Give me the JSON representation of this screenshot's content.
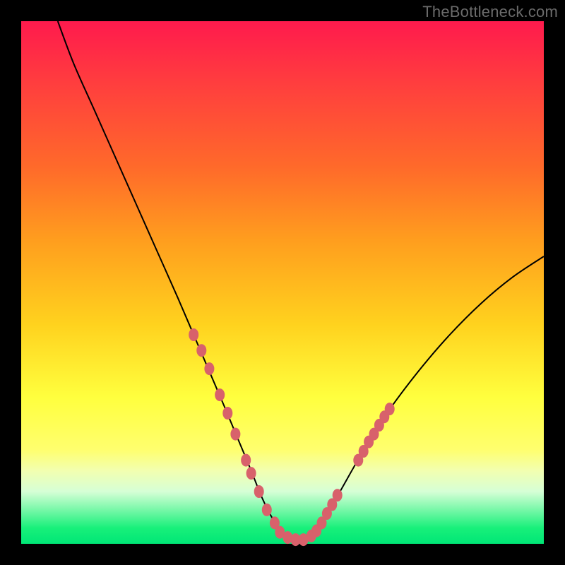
{
  "watermark": "TheBottleneck.com",
  "colors": {
    "frame": "#000000",
    "gradient_top": "#ff1a4d",
    "gradient_bottom": "#00e676",
    "curve": "#000000",
    "beads": "#d8616b"
  },
  "chart_data": {
    "type": "line",
    "title": "",
    "xlabel": "",
    "ylabel": "",
    "xlim": [
      0,
      100
    ],
    "ylim": [
      0,
      100
    ],
    "series": [
      {
        "name": "bottleneck-curve",
        "x": [
          7,
          10,
          14,
          18,
          22,
          26,
          30,
          33,
          36,
          39,
          41.5,
          44,
          46,
          48,
          50,
          52,
          54,
          56,
          58,
          61,
          65,
          70,
          76,
          82,
          88,
          94,
          100
        ],
        "y": [
          100,
          92,
          83,
          74,
          65,
          56,
          47,
          40,
          33,
          26,
          20,
          14,
          9,
          5,
          2,
          0.5,
          0.5,
          2,
          5,
          10,
          17,
          25,
          33,
          40,
          46,
          51,
          55
        ]
      }
    ],
    "annotations": {
      "beads_left": [
        {
          "x": 33.0,
          "y": 40.0
        },
        {
          "x": 34.5,
          "y": 37.0
        },
        {
          "x": 36.0,
          "y": 33.5
        },
        {
          "x": 38.0,
          "y": 28.5
        },
        {
          "x": 39.5,
          "y": 25.0
        },
        {
          "x": 41.0,
          "y": 21.0
        },
        {
          "x": 43.0,
          "y": 16.0
        },
        {
          "x": 44.0,
          "y": 13.5
        },
        {
          "x": 45.5,
          "y": 10.0
        },
        {
          "x": 47.0,
          "y": 6.5
        },
        {
          "x": 48.5,
          "y": 4.0
        }
      ],
      "beads_bottom": [
        {
          "x": 49.5,
          "y": 2.2
        },
        {
          "x": 51.0,
          "y": 1.2
        },
        {
          "x": 52.5,
          "y": 0.8
        },
        {
          "x": 54.0,
          "y": 0.8
        },
        {
          "x": 55.5,
          "y": 1.5
        },
        {
          "x": 56.5,
          "y": 2.5
        }
      ],
      "beads_right": [
        {
          "x": 57.5,
          "y": 4.0
        },
        {
          "x": 58.5,
          "y": 5.8
        },
        {
          "x": 59.5,
          "y": 7.5
        },
        {
          "x": 60.5,
          "y": 9.3
        },
        {
          "x": 64.5,
          "y": 16.0
        },
        {
          "x": 65.5,
          "y": 17.7
        },
        {
          "x": 66.5,
          "y": 19.5
        },
        {
          "x": 67.5,
          "y": 21.0
        },
        {
          "x": 68.5,
          "y": 22.7
        },
        {
          "x": 69.5,
          "y": 24.3
        },
        {
          "x": 70.5,
          "y": 25.8
        }
      ]
    }
  }
}
